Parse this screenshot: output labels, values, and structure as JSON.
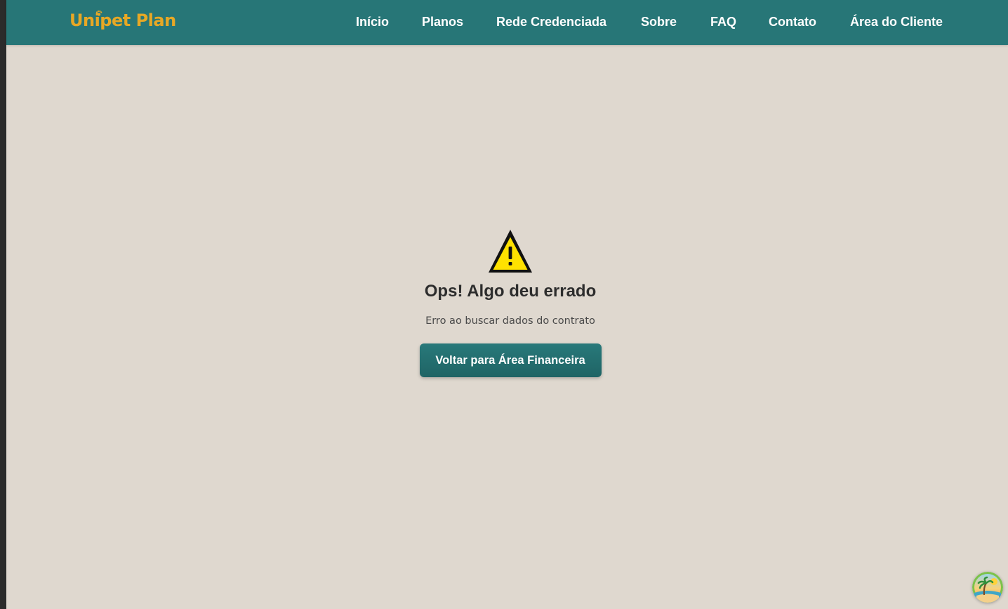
{
  "header": {
    "logo_text": "Unipet Plan",
    "brand_color": "#e7a825",
    "background_color": "#277677",
    "nav": [
      {
        "label": "Início"
      },
      {
        "label": "Planos"
      },
      {
        "label": "Rede Credenciada"
      },
      {
        "label": "Sobre"
      },
      {
        "label": "FAQ"
      },
      {
        "label": "Contato"
      },
      {
        "label": "Área do Cliente"
      }
    ]
  },
  "error": {
    "icon": "warning-triangle-icon",
    "icon_color": "#ffe100",
    "title": "Ops! Algo deu errado",
    "message": "Erro ao buscar dados do contrato",
    "button_label": "Voltar para Área Financeira"
  },
  "widget": {
    "icon": "beach-island-icon"
  }
}
